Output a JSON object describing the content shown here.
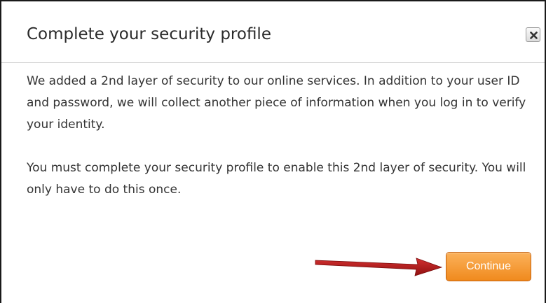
{
  "dialog": {
    "title": "Complete your security profile",
    "close_icon": "close-icon",
    "paragraphs": [
      "We added a 2nd layer of security to our online services. In addition to your user ID and password, we will collect another piece of information when you log in to verify your identity.",
      "You must complete your security profile to enable this 2nd layer of security. You will only have to do this once."
    ],
    "continue_label": "Continue"
  },
  "annotation": {
    "icon": "arrow-right-icon"
  },
  "colors": {
    "button_top": "#fbb25b",
    "button_bottom": "#f08a1d",
    "button_border": "#c45f0a",
    "arrow": "#b51a1a",
    "frame_border": "#1a1a1a",
    "divider": "#d4d4d4"
  }
}
